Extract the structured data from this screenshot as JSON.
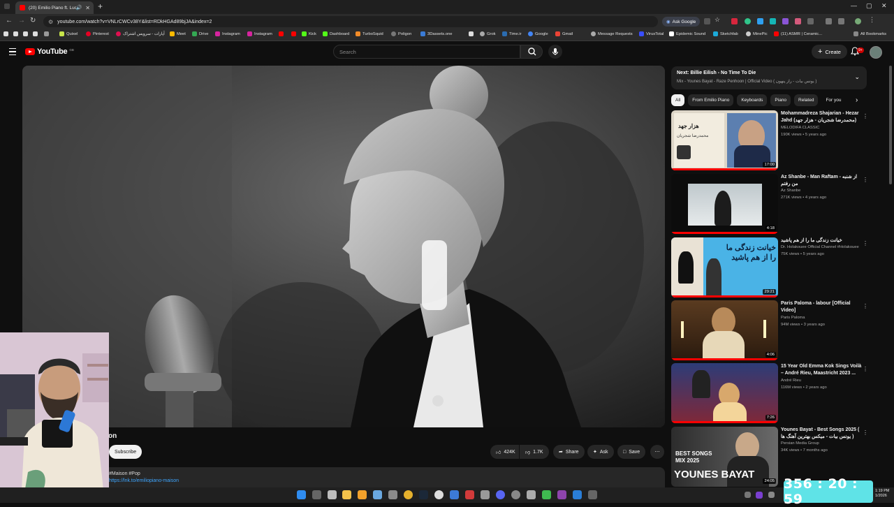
{
  "browser": {
    "tab_title": "(20) Emilio Piano ft. Lucie –",
    "url": "youtube.com/watch?v=VNLrCWCv38Y&list=RDkHGAd89bjJA&index=2",
    "ask_google_label": "Ask Google",
    "bookmarks": [
      "Quixel",
      "Pinterest",
      "آپارات - سرویس اشتراک",
      "Meet",
      "Drive",
      "Instagram",
      "Instagram",
      "",
      "",
      "Kick",
      "Dashboard",
      "TurboSquid",
      "Poligon",
      "3Dassets.one",
      "",
      "Grok",
      "Time.ir",
      "Google",
      "Gmail",
      "Message Requests",
      "VirusTotal",
      "Epidemic Sound",
      "Sketchfab",
      "MinePic",
      "(11) ASMR | Ceramic..."
    ],
    "all_bookmarks_label": "All Bookmarks"
  },
  "youtube": {
    "logo_text": "YouTube",
    "country_code": "GB",
    "search_placeholder": "Search",
    "create_label": "Create",
    "notification_count": "9+"
  },
  "video": {
    "title_fragment": "on",
    "subscribe_label": "Subscribe",
    "like_count": "424K",
    "dislike_count": "1.7K",
    "share_label": "Share",
    "ask_label": "Ask",
    "save_label": "Save",
    "description_line1": "#Maison #Pop",
    "description_link": "https://lnk.to/emiliopiano-maison"
  },
  "sidebar": {
    "next_label": "Next: Billie Eilish - No Time To Die",
    "mix_label": "Mix - Younes Bayat - Raze Penhoon | Official Video ( یونس بیات - راز پنهون )",
    "chips": [
      "All",
      "From Emilio Piano",
      "Keyboards",
      "Piano",
      "Related",
      "For you"
    ],
    "recommendations": [
      {
        "title": "Mohammadreza Shajarian - Hezar Jahd (محمدرضا شجریان - هزار جهد)",
        "channel": "MELODIFA CLASSIC",
        "meta": "190K views • 5 years ago",
        "duration": "17:00",
        "thumb_text": "هزار جهد",
        "thumb_sub": "محمدرضا شجریان",
        "watched": 1.0
      },
      {
        "title": "Az Shanbe - Man Raftam - از شنبه من رفتم",
        "channel": "Az Shanbe",
        "meta": "271K views • 4 years ago",
        "duration": "4:18",
        "watched": 1.0
      },
      {
        "title": "خیانت زندگی ما را از هم پاشید",
        "channel": "Dr. Holakouee Official Channel #Holakouee",
        "meta": "75K views • 5 years ago",
        "duration": "29:21",
        "thumb_text": "خیانت زندگی ما را از هم پاشید",
        "watched": 1.0
      },
      {
        "title": "Paris Paloma - labour [Official Video]",
        "channel": "Paris Paloma",
        "meta": "94M views • 3 years ago",
        "duration": "4:06",
        "watched": 1.0
      },
      {
        "title": "15 Year Old Emma Kok Sings Voilà – André Rieu, Maastricht 2023 ...",
        "channel": "André Rieu",
        "meta": "116M views • 2 years ago",
        "duration": "7:26",
        "watched": 1.0
      },
      {
        "title": "Younes Bayat - Best Songs 2025 ( یونس بیات - میکس بهترین آهنگ ها )",
        "channel": "Persian Media Group",
        "meta": "34K views • 7 months ago",
        "duration": "24:05",
        "thumb_text": "BEST SONGS MIX 2025",
        "thumb_big": "YOUNES BAYAT",
        "watched": 0
      }
    ]
  },
  "overlay": {
    "timer": "356 : 20 : 59",
    "clock_time": "1:19 PM",
    "clock_date": "1/2026"
  },
  "colors": {
    "background": "#0f0f0f",
    "accent_red": "#ff0000",
    "link_blue": "#3ea6ff",
    "timer_bg": "#5fe3e7"
  }
}
